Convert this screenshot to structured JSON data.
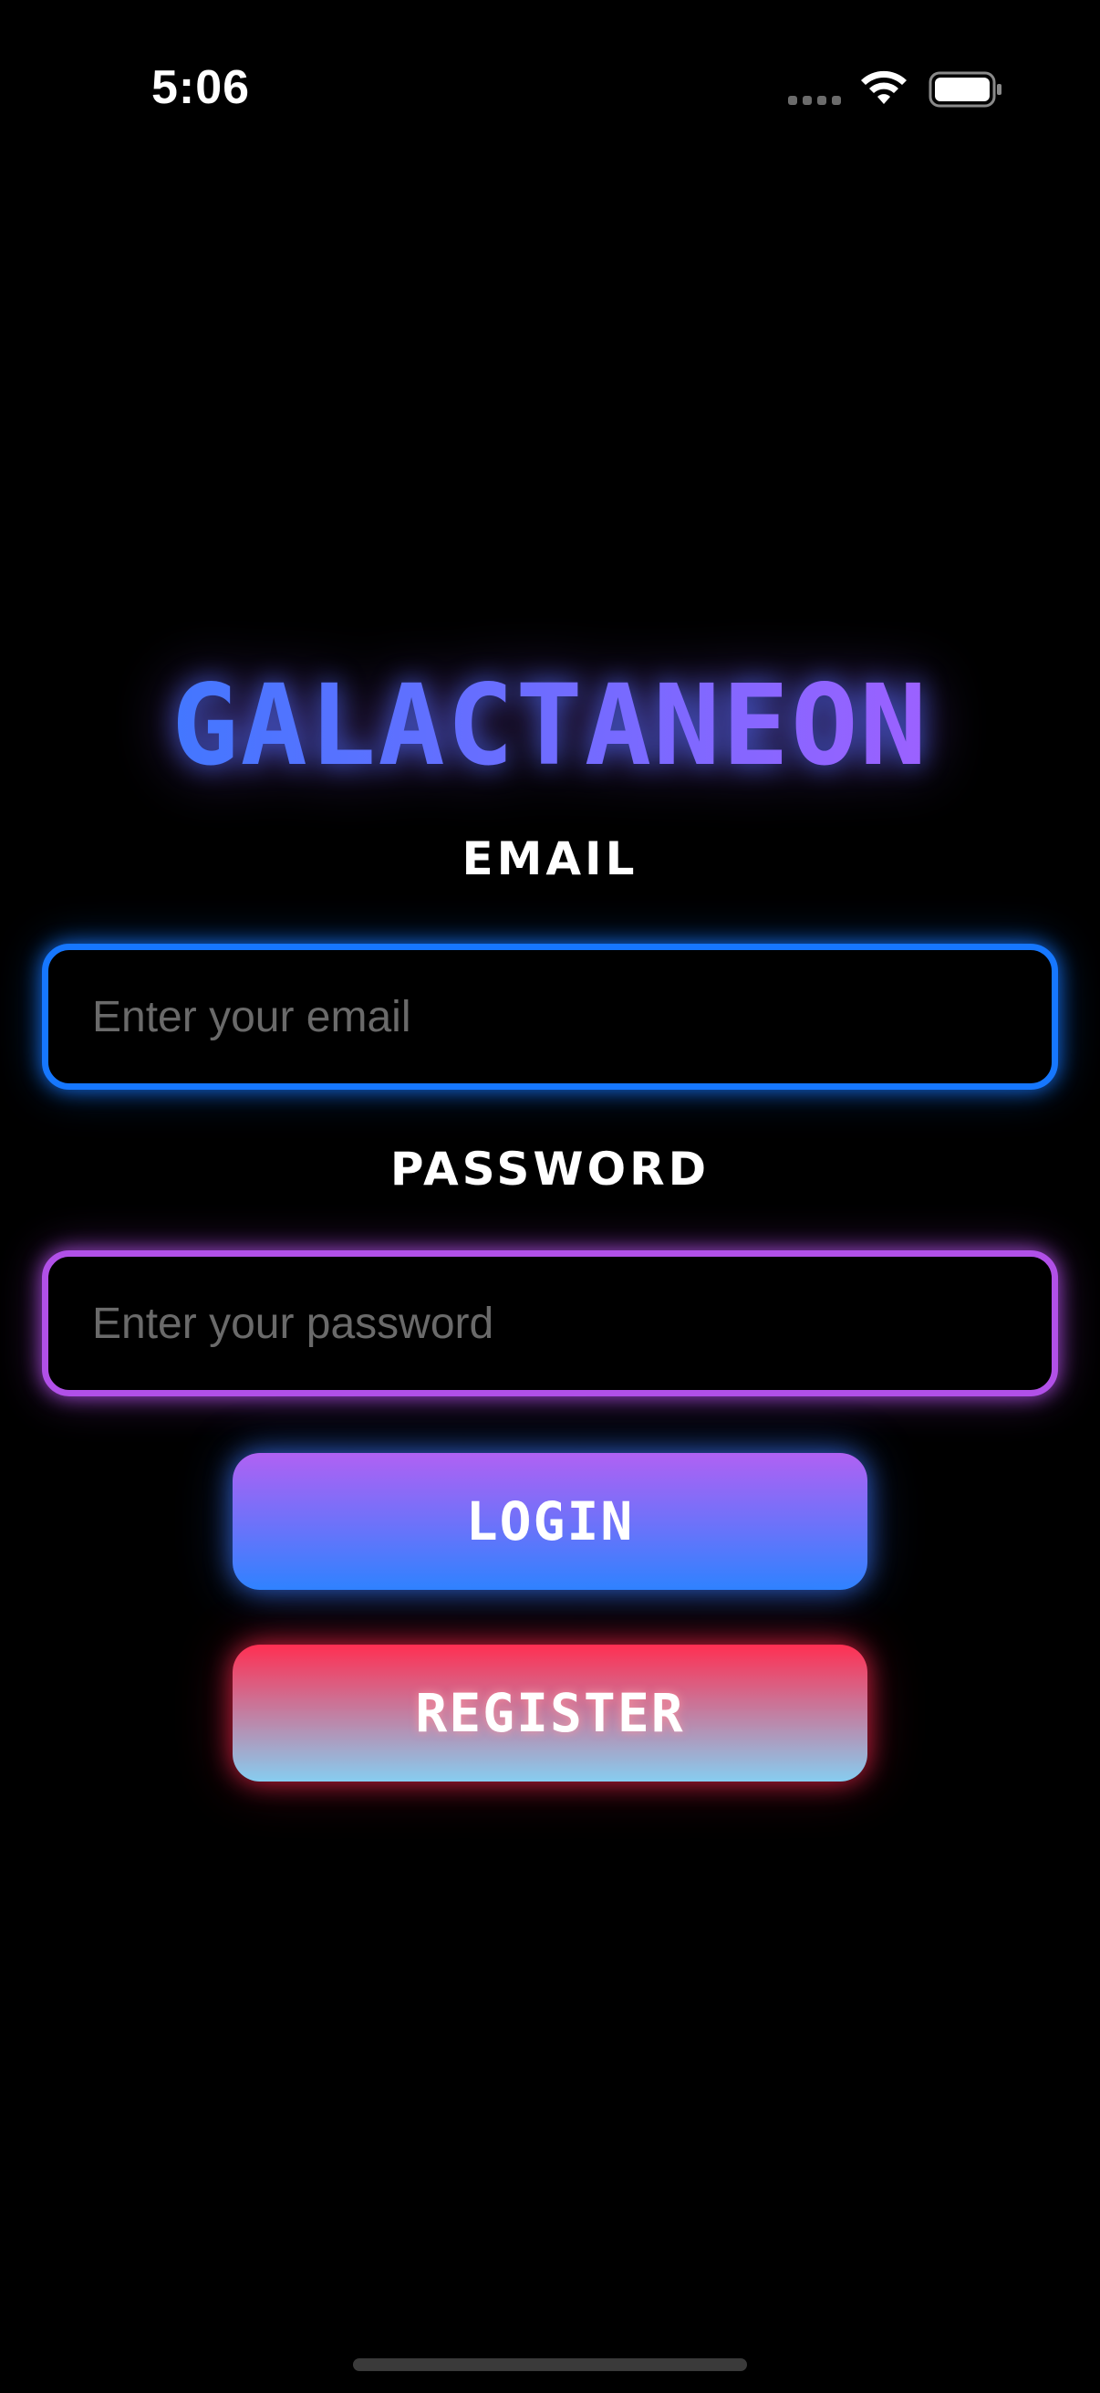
{
  "status_bar": {
    "time": "5:06",
    "icons": [
      "signal-dots-icon",
      "wifi-icon",
      "battery-icon"
    ]
  },
  "app": {
    "title": "GALACTANEON"
  },
  "form": {
    "email_label": "EMAIL",
    "email_placeholder": "Enter your email",
    "email_value": "",
    "password_label": "PASSWORD",
    "password_placeholder": "Enter your password",
    "password_value": "",
    "login_label": "LOGIN",
    "register_label": "REGISTER"
  },
  "colors": {
    "background": "#000000",
    "email_border": "#1677ff",
    "password_border": "#b150e8",
    "login_gradient": [
      "#b061f3",
      "#2f82ff"
    ],
    "register_gradient": [
      "#ff2f52",
      "#87cdf0"
    ],
    "title_gradient": [
      "#2f7cff",
      "#b05cff"
    ]
  }
}
